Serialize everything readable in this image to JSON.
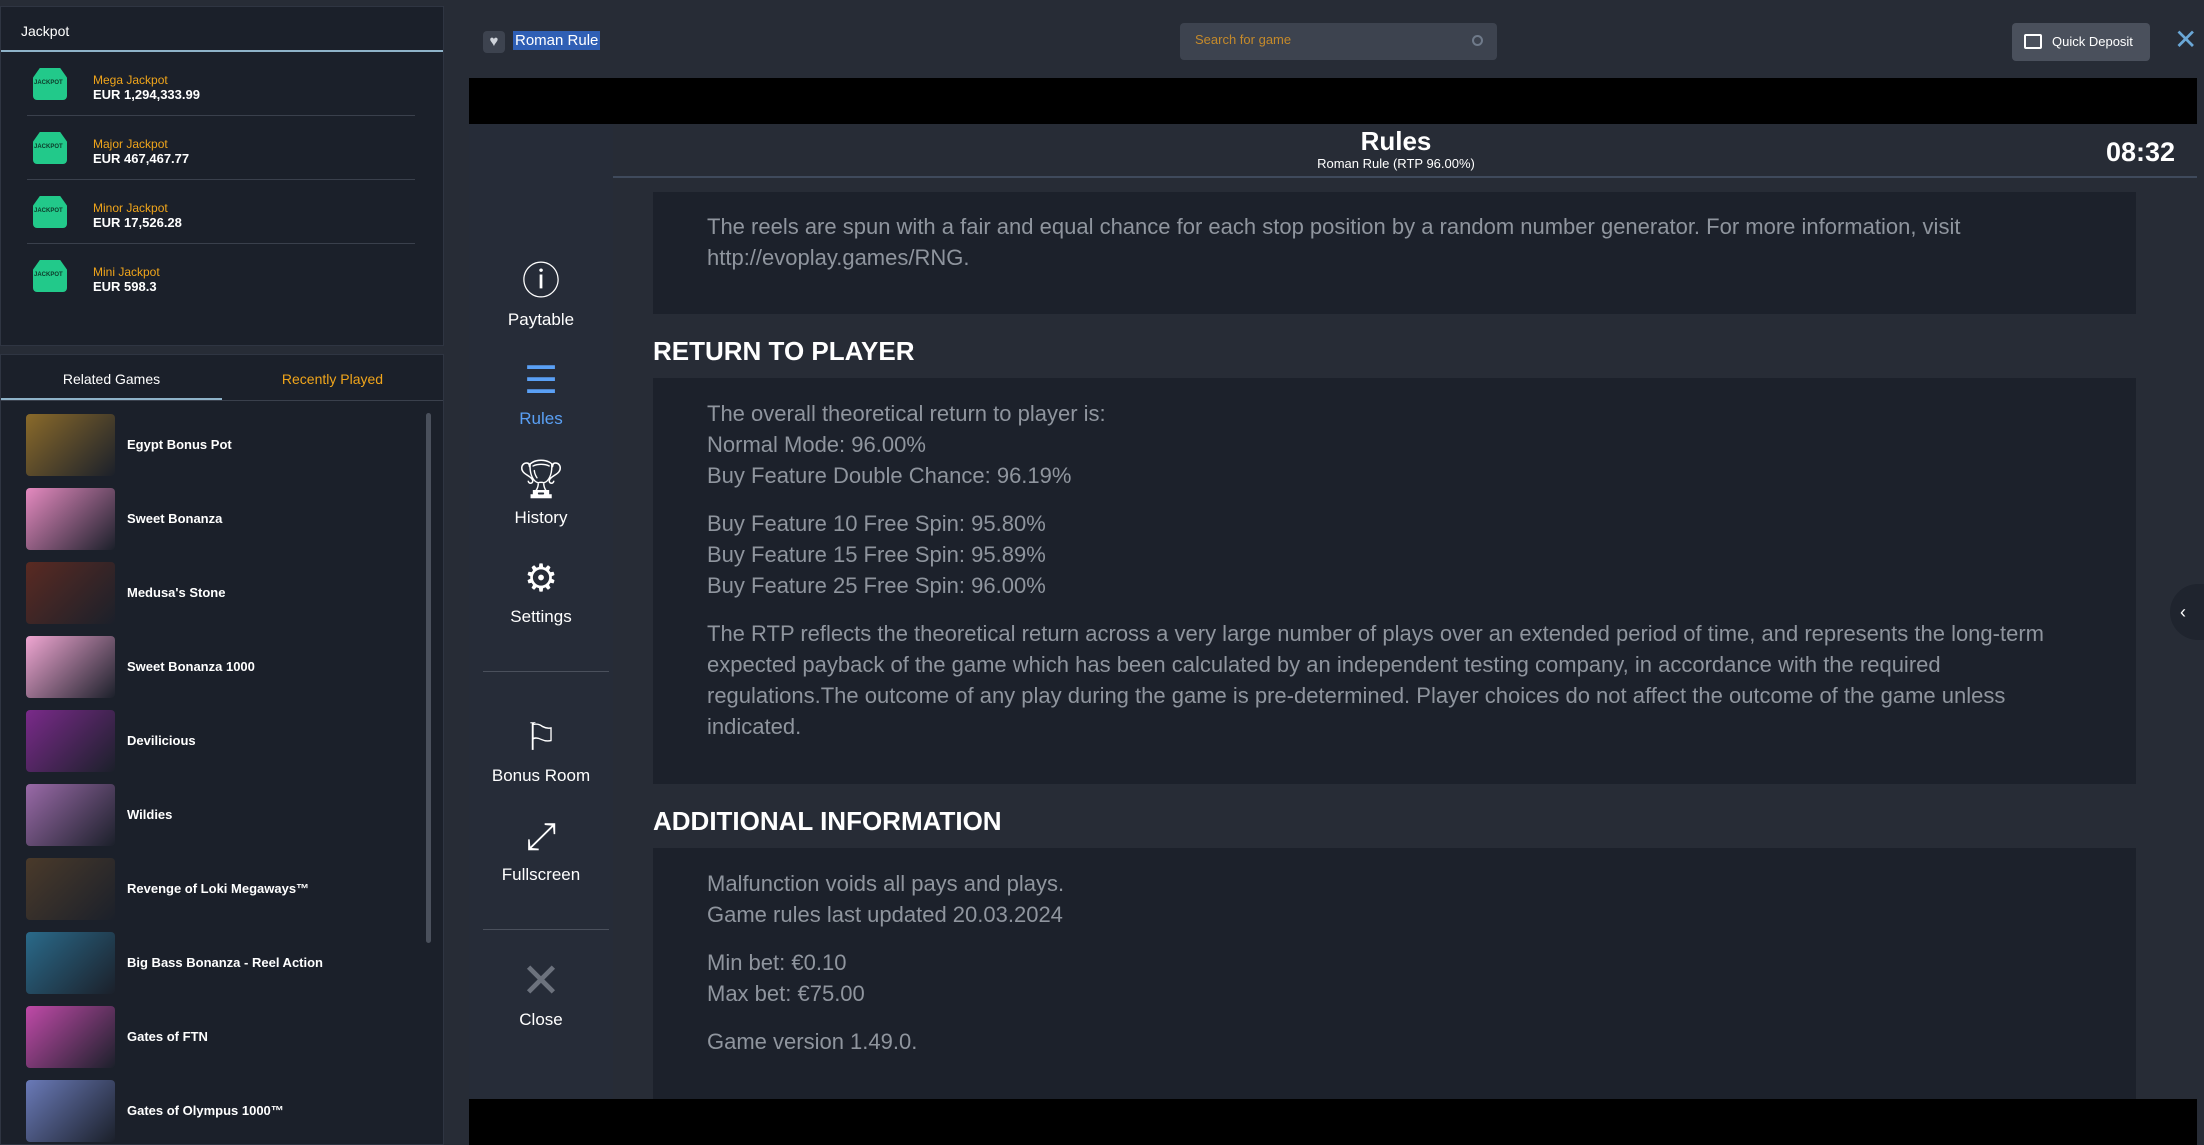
{
  "jackpot": {
    "title": "Jackpot",
    "items": [
      {
        "name": "Mega Jackpot",
        "amount": "EUR 1,294,333.99"
      },
      {
        "name": "Major Jackpot",
        "amount": "EUR 467,467.77"
      },
      {
        "name": "Minor Jackpot",
        "amount": "EUR 17,526.28"
      },
      {
        "name": "Mini Jackpot",
        "amount": "EUR 598.3"
      }
    ]
  },
  "tabs": {
    "related": "Related Games",
    "recent": "Recently Played"
  },
  "games": [
    {
      "name": "Egypt Bonus Pot",
      "color": "#8a6a2a"
    },
    {
      "name": "Sweet Bonanza",
      "color": "#e58ac0"
    },
    {
      "name": "Medusa's Stone",
      "color": "#5a2a22"
    },
    {
      "name": "Sweet Bonanza 1000",
      "color": "#f0a6d2"
    },
    {
      "name": "Devilicious",
      "color": "#7a2a8a"
    },
    {
      "name": "Wildies",
      "color": "#9a6aa8"
    },
    {
      "name": "Revenge of Loki Megaways™",
      "color": "#4a3a2a"
    },
    {
      "name": "Big Bass Bonanza - Reel Action",
      "color": "#2a6a8a"
    },
    {
      "name": "Gates of FTN",
      "color": "#c04aa8"
    },
    {
      "name": "Gates of Olympus 1000™",
      "color": "#6a7ab8"
    }
  ],
  "topbar": {
    "title": "Roman Rule",
    "search_placeholder": "Search for game",
    "quick_deposit": "Quick Deposit"
  },
  "menu": {
    "paytable": "Paytable",
    "rules": "Rules",
    "history": "History",
    "settings": "Settings",
    "bonus_room": "Bonus Room",
    "fullscreen": "Fullscreen",
    "close": "Close"
  },
  "rules": {
    "title": "Rules",
    "subtitle": "Roman Rule (RTP 96.00%)",
    "time": "08:32",
    "rng_text": "The reels are spun with a fair and equal chance for each stop position by a random number generator. For more information, visit http://evoplay.games/RNG.",
    "rtp_heading": "RETURN TO PLAYER",
    "rtp_lines": [
      "The overall theoretical return to player is:",
      "Normal Mode: 96.00%",
      "Buy Feature Double Chance: 96.19%"
    ],
    "buy_lines": [
      "Buy Feature 10 Free Spin: 95.80%",
      "Buy Feature 15 Free Spin: 95.89%",
      "Buy Feature 25 Free Spin: 96.00%"
    ],
    "rtp_note": "The RTP reflects the theoretical return across a very large number of plays over an extended period of time, and represents the long-term expected payback of the game which has been calculated by an independent testing company, in accordance with the required regulations.The outcome of any play during the game is pre-determined. Player choices do not affect the outcome of the game unless indicated.",
    "info_heading": "ADDITIONAL INFORMATION",
    "info_lines": [
      "Malfunction voids all pays and plays.",
      "Game rules last updated 20.03.2024"
    ],
    "bet_lines": [
      "Min bet: €0.10",
      "Max bet: €75.00"
    ],
    "version": "Game version 1.49.0."
  }
}
